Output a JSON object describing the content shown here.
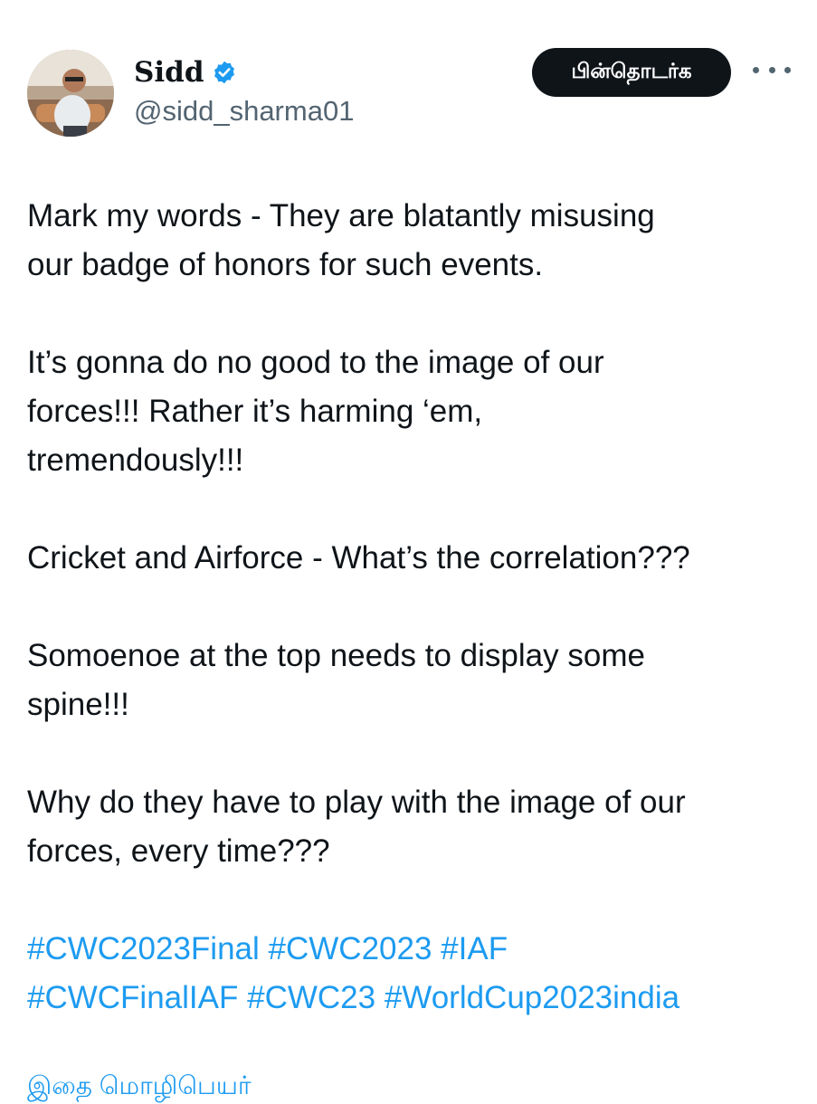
{
  "user": {
    "display_name": "Sidd",
    "handle": "@sidd_sharma01",
    "verified_icon": "verified-badge-icon"
  },
  "actions": {
    "follow_label": "பின்தொடர்க",
    "more_icon": "more-options-icon"
  },
  "tweet": {
    "paragraphs": [
      "Mark my words - They are blatantly misusing\nour badge of honors for such events.",
      "It’s gonna do no good to the image of our\nforces!!! Rather it’s harming ‘em,\ntremendously!!!",
      "Cricket and Airforce - What’s the correlation???",
      "Somoenoe at the top needs to display some\nspine!!!",
      "Why do they have to play with the image of our\nforces, every time???"
    ],
    "hashtags": [
      "#CWC2023Final",
      "#CWC2023",
      "#IAF",
      "#CWCFinalIAF",
      "#CWC23",
      "#WorldCup2023india"
    ]
  },
  "footer": {
    "translate_label": "இதை மொழிபெயர்"
  },
  "colors": {
    "link": "#1d9bf0",
    "text": "#0f1419",
    "secondary": "#536471",
    "follow_bg": "#0f1419"
  }
}
